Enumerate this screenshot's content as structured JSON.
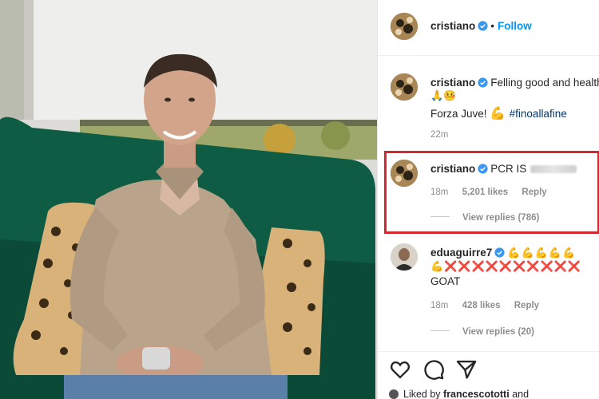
{
  "post": {
    "username": "cristiano",
    "follow_label": "Follow",
    "separator": "•"
  },
  "caption": {
    "username": "cristiano",
    "text_line1": "Felling good and healthy",
    "text_line1_emojis": "🙏🤒",
    "text_line2_prefix": "Forza Juve! ",
    "flex_emoji": "💪",
    "hashtag": "#finoallafine",
    "time": "22m"
  },
  "comment1": {
    "username": "cristiano",
    "text": "PCR IS",
    "time": "18m",
    "likes": "5,201 likes",
    "reply_label": "Reply",
    "view_replies": "View replies (786)"
  },
  "comment2": {
    "username": "eduaguirre7",
    "emojis_line1": "💪💪💪💪💪",
    "emojis_line2": "💪❌❌❌❌❌❌❌❌❌❌",
    "text": "GOAT",
    "time": "18m",
    "likes": "428 likes",
    "reply_label": "Reply",
    "view_replies": "View replies (20)"
  },
  "footer": {
    "liked_by_prefix": "Liked by ",
    "liked_by_user": "francescototti",
    "liked_by_suffix": " and"
  },
  "icons": {
    "like": "heart-icon",
    "comment": "comment-icon",
    "share": "send-icon",
    "verified": "verified-badge-icon"
  },
  "colors": {
    "accent": "#0095f6",
    "highlight": "#d3282e",
    "sofa": "#0f5c45"
  }
}
